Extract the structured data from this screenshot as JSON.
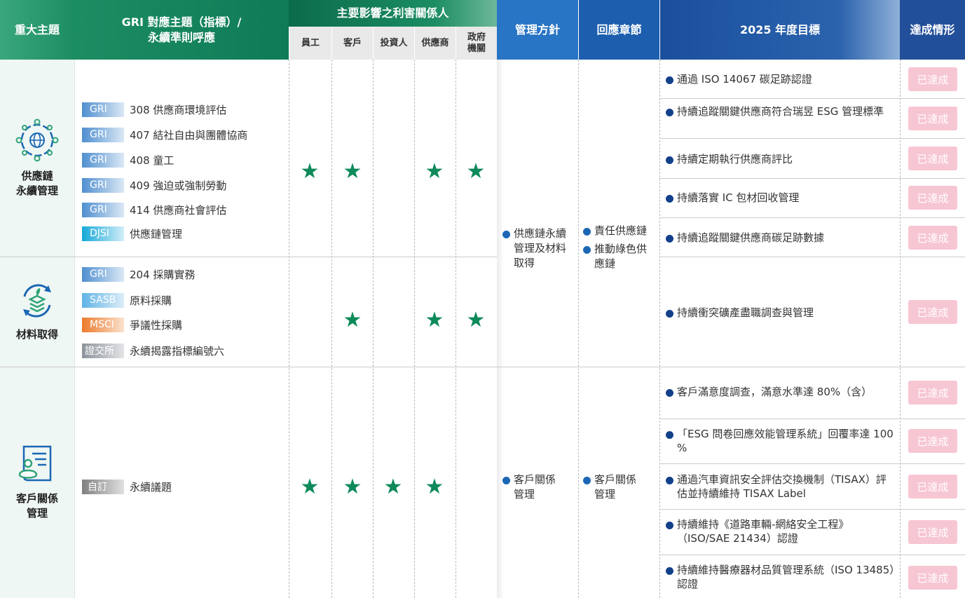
{
  "header": {
    "topic": "重大主題",
    "gri_line1": "GRI 對應主題（指標）/",
    "gri_line2": "永續準則呼應",
    "stakeholders": "主要影響之利害關係人",
    "stakeholder_cols": [
      "員工",
      "客戶",
      "投資人",
      "供應商",
      "政府\n機關"
    ],
    "policy": "管理方針",
    "chapter": "回應章節",
    "target": "2025 年度目標",
    "status": "達成情形"
  },
  "topics": [
    {
      "name_line1": "供應鏈",
      "name_line2": "永續管理",
      "icon": "globe-gear-icon",
      "gri": [
        {
          "badge": "GRI",
          "text": "308 供應商環境評估"
        },
        {
          "badge": "GRI",
          "text": "407 結社自由與團體協商"
        },
        {
          "badge": "GRI",
          "text": "408 童工"
        },
        {
          "badge": "GRI",
          "text": "409 強迫或強制勞動"
        },
        {
          "badge": "GRI",
          "text": "414 供應商社會評估"
        },
        {
          "badge": "DJSI",
          "text": "供應鏈管理"
        }
      ],
      "stakeholders": [
        true,
        true,
        false,
        true,
        true
      ]
    },
    {
      "name_line1": "材料取得",
      "name_line2": "",
      "icon": "recycle-stack-icon",
      "gri": [
        {
          "badge": "GRI",
          "text": "204 採購實務"
        },
        {
          "badge": "SASB",
          "text": "原料採購"
        },
        {
          "badge": "MSCI",
          "text": "爭議性採購"
        },
        {
          "badge": "證交所",
          "text": "永續揭露指標編號六"
        }
      ],
      "stakeholders": [
        false,
        true,
        false,
        true,
        true
      ]
    },
    {
      "name_line1": "客戶關係",
      "name_line2": "管理",
      "icon": "customer-doc-icon",
      "gri": [
        {
          "badge": "自訂",
          "text": "永續議題"
        }
      ],
      "stakeholders": [
        true,
        true,
        true,
        true,
        false
      ]
    }
  ],
  "policy_1": [
    "供應鏈永續",
    "管理及材料",
    "取得"
  ],
  "chapter_1": [
    [
      "責任供應鏈"
    ],
    [
      "推動綠色供",
      "應鏈"
    ]
  ],
  "policy_2": [
    "客戶關係",
    "管理"
  ],
  "chapter_2": [
    "客戶關係",
    "管理"
  ],
  "targets": [
    {
      "text": "通過 ISO 14067 碳足跡認證",
      "status": "已達成"
    },
    {
      "text": "持續追蹤關鍵供應商符合瑞昱 ESG 管理標準",
      "status": "已達成"
    },
    {
      "text": "持續定期執行供應商評比",
      "status": "已達成"
    },
    {
      "text": "持續落實 IC 包材回收管理",
      "status": "已達成"
    },
    {
      "text": "持續追蹤關鍵供應商碳足跡數據",
      "status": "已達成"
    },
    {
      "text": "持續衝突礦產盡職調查與管理",
      "status": "已達成"
    },
    {
      "text": "客戶滿意度調查，滿意水準達 80%（含）",
      "status": "已達成"
    },
    {
      "text": "「ESG 問卷回應效能管理系統」回覆率達 100 %",
      "status": "已達成"
    },
    {
      "text": "通過汽車資訊安全評估交換機制（TISAX）評估並持續維持 TISAX Label",
      "status": "已達成"
    },
    {
      "text": "持續維持《道路車輛-網絡安全工程》（ISO/SAE 21434）認證",
      "status": "已達成"
    },
    {
      "text": "持續維持醫療器材品質管理系統（ISO 13485）認證",
      "status": "已達成"
    }
  ],
  "colors": {
    "green_dark": "#0c7a55",
    "green_light": "#3aa77c",
    "blue_dark": "#1a4f9c",
    "blue_mid": "#2a6fc0",
    "star": "#0e8a5a",
    "bullet": "#1b67b4",
    "achieved": "#f7c6d3",
    "badge_gri": "#4f8fd0",
    "badge_djsi": "#15a9d8",
    "badge_sasb": "#5fb3e6",
    "badge_msci": "#ec7a2a",
    "badge_twse": "#8c939a",
    "badge_custom": "#808080"
  }
}
